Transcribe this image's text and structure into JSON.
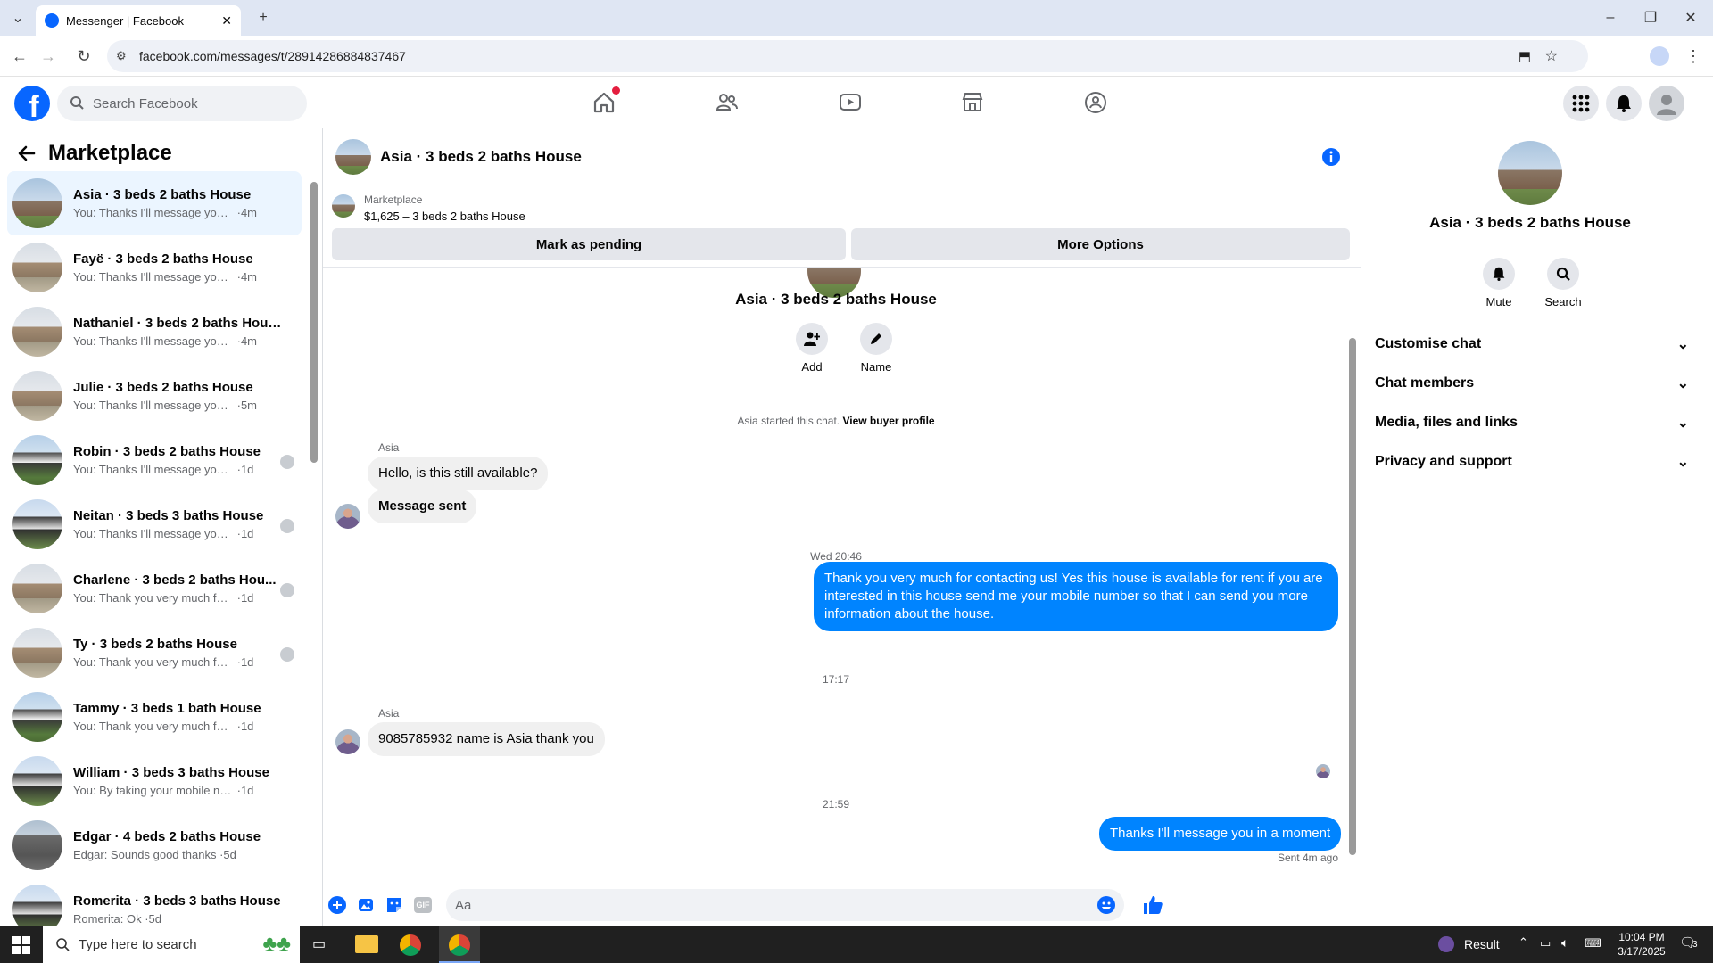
{
  "browser": {
    "tab_title": "Messenger | Facebook",
    "url": "facebook.com/messages/t/28914286884837467"
  },
  "facebook": {
    "logo_letter": "f",
    "search_placeholder": "Search Facebook"
  },
  "sidebar": {
    "title": "Marketplace",
    "conversations": [
      {
        "name": "Asia · 3 beds 2 baths House",
        "preview": "You: Thanks I'll message you in a ...",
        "time": "4m",
        "thumb": "house"
      },
      {
        "name": "Fayë · 3 beds 2 baths House",
        "preview": "You: Thanks I'll message you in a ...",
        "time": "4m",
        "thumb": "house2"
      },
      {
        "name": "Nathaniel · 3 beds 2 baths House",
        "preview": "You: Thanks I'll message you in a ...",
        "time": "4m",
        "thumb": "house2"
      },
      {
        "name": "Julie · 3 beds 2 baths House",
        "preview": "You: Thanks I'll message you in a ...",
        "time": "5m",
        "thumb": "house2"
      },
      {
        "name": "Robin · 3 beds 2 baths House",
        "preview": "You: Thanks I'll message you in ...",
        "time": "1d",
        "thumb": "house3"
      },
      {
        "name": "Neitan · 3 beds 3 baths House",
        "preview": "You: Thanks I'll message you in ...",
        "time": "1d",
        "thumb": "house4"
      },
      {
        "name": "Charlene · 3 beds 2 baths Hou...",
        "preview": "You: Thank you very much for co...",
        "time": "1d",
        "thumb": "house2"
      },
      {
        "name": "Ty · 3 beds 2 baths House",
        "preview": "You: Thank you very much for co...",
        "time": "1d",
        "thumb": "house2"
      },
      {
        "name": "Tammy · 3 beds 1 bath House",
        "preview": "You: Thank you very much for cont...",
        "time": "1d",
        "thumb": "house3"
      },
      {
        "name": "William · 3 beds 3 baths House",
        "preview": "You: By taking your mobile number...",
        "time": "1d",
        "thumb": "house4"
      },
      {
        "name": "Edgar · 4 beds 2 baths House",
        "preview": "Edgar: Sounds good thanks",
        "time": "5d",
        "thumb": "house5"
      },
      {
        "name": "Romerita · 3 beds 3 baths House",
        "preview": "Romerita: Ok",
        "time": "5d",
        "thumb": "house4"
      }
    ]
  },
  "chat": {
    "title": "Asia · 3 beds 2 baths House",
    "listing_label": "Marketplace",
    "listing_desc": "$1,625 – 3 beds 2 baths House",
    "mark_pending": "Mark as pending",
    "more_options": "More Options",
    "intro_name": "Asia · 3 beds 2 baths House",
    "add_label": "Add",
    "name_label": "Name",
    "started_text": "Asia started this chat. ",
    "buyer_profile_link": "View buyer profile",
    "sender1": "Asia",
    "msg1": "Hello, is this still available?",
    "msg2": "Message sent",
    "time1": "Wed 20:46",
    "msg3": "Thank you very much for contacting us! Yes this house is available for rent if you are interested in this house send me your mobile number so that I can send you more information about the house.",
    "time2": "17:17",
    "sender2": "Asia",
    "msg4": "9085785932 name is Asia thank you",
    "time3": "21:59",
    "msg5": "Thanks I'll message you in a moment",
    "sent_status": "Sent 4m ago",
    "composer_placeholder": "Aa"
  },
  "right_panel": {
    "title": "Asia · 3 beds 2 baths House",
    "mute_label": "Mute",
    "search_label": "Search",
    "sections": [
      "Customise chat",
      "Chat members",
      "Media, files and links",
      "Privacy and support"
    ]
  },
  "taskbar": {
    "search_placeholder": "Type here to search",
    "result_label": "Result",
    "time": "10:04 PM",
    "date": "3/17/2025",
    "notif_count": "3"
  },
  "colors": {
    "facebook_blue": "#0866ff",
    "messenger_blue": "#0084ff",
    "active_row": "#ebf5ff"
  }
}
